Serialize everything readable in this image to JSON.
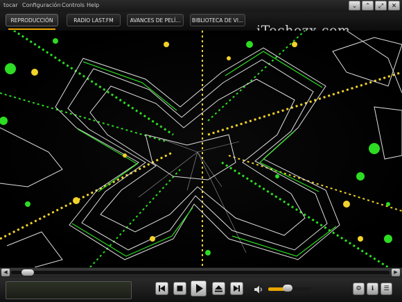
{
  "menu": {
    "items": [
      "tocar",
      "Configuración",
      "Controls",
      "Help"
    ]
  },
  "window_controls": {
    "minimize_icon": "chevron-down-icon",
    "restore_icon": "chevron-up-icon",
    "fullscreen_icon": "expand-icon",
    "close_icon": "close-icon"
  },
  "tabs": [
    {
      "label": "REPRODUCCIÓN",
      "active": true
    },
    {
      "label": "RADIO LAST.FM",
      "active": false
    },
    {
      "label": "AVANCES DE PELÍ...",
      "active": false
    },
    {
      "label": "BIBLIOTECA DE VI...",
      "active": false
    }
  ],
  "watermark": "iTechezx.com",
  "colors": {
    "accent": "#e8a600",
    "visual_green": "#2ddc23",
    "visual_yellow": "#f0d22a"
  },
  "playback": {
    "seek_progress": 0.02,
    "volume": 0.45
  },
  "transport_icons": [
    "previous-icon",
    "stop-icon",
    "play-icon",
    "eject-icon",
    "next-icon"
  ],
  "right_icons": [
    "gear-icon",
    "info-icon",
    "playlist-icon"
  ]
}
